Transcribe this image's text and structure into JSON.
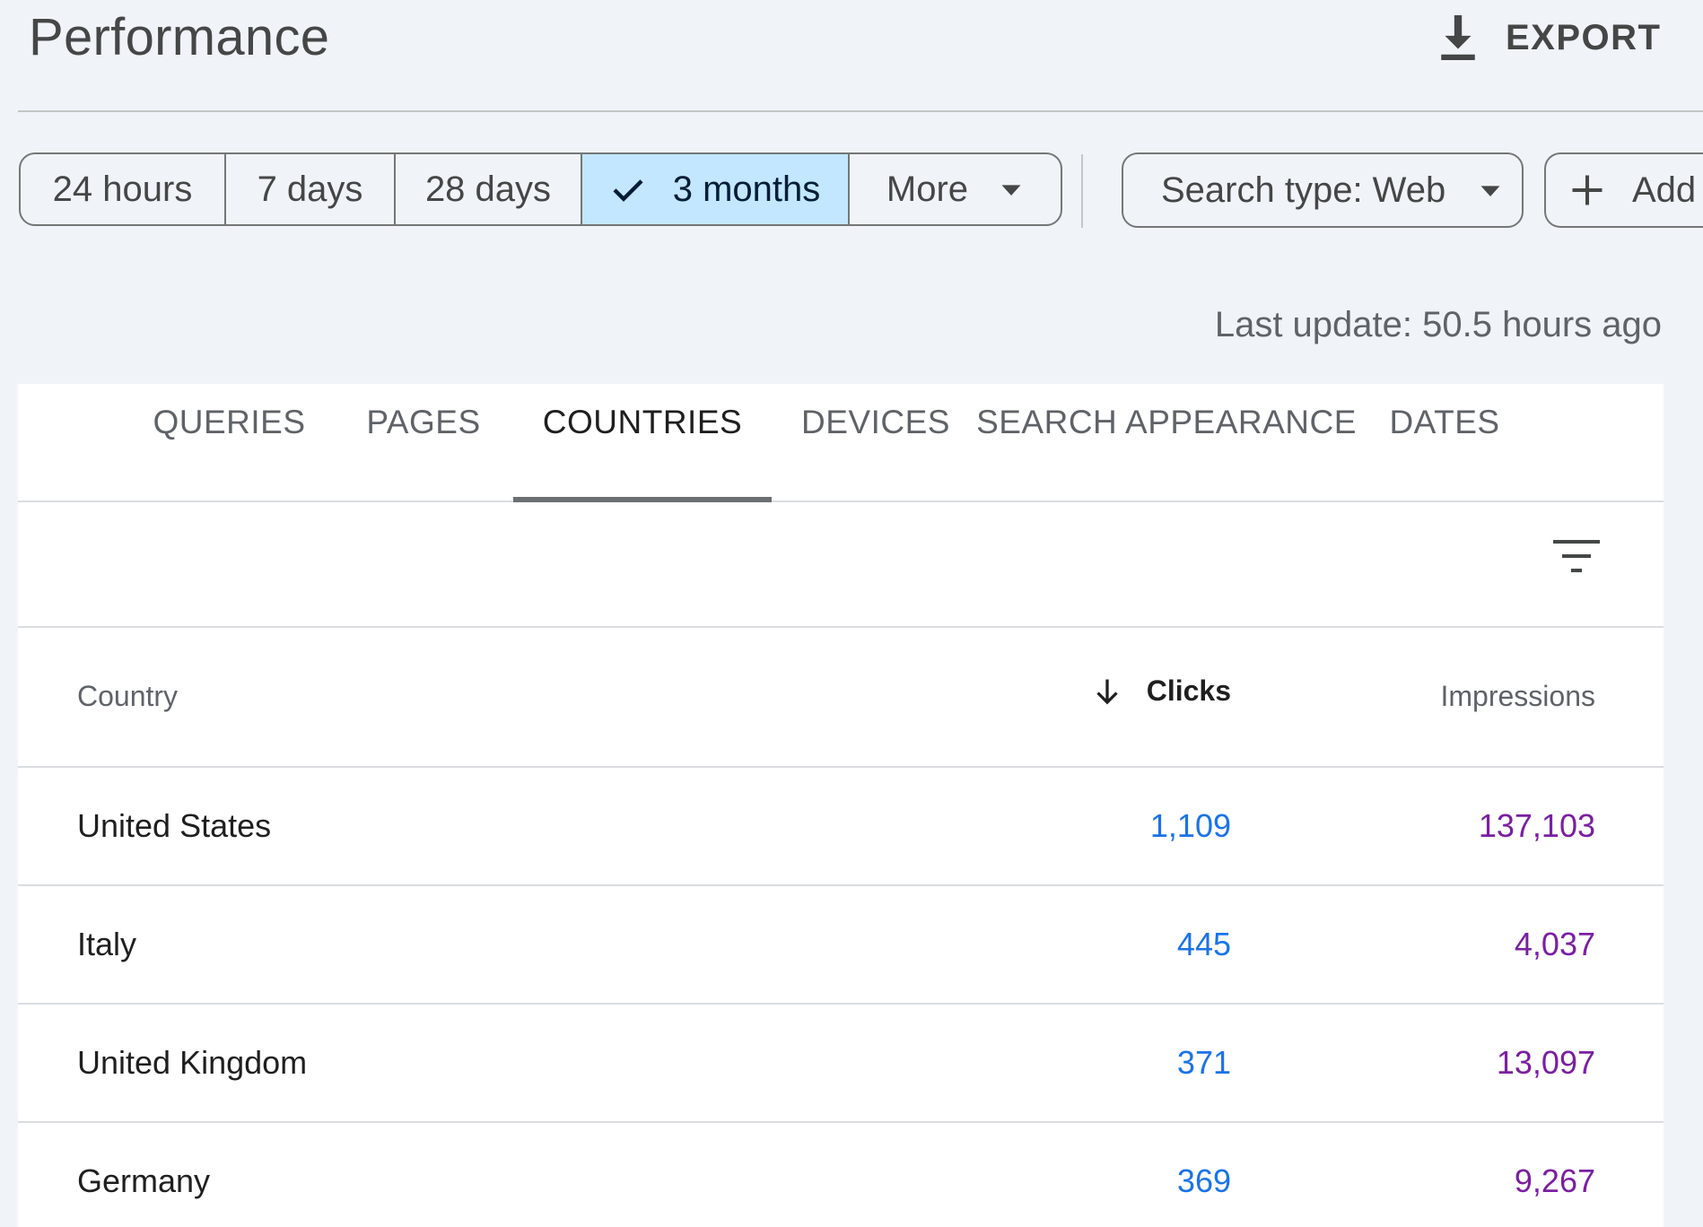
{
  "header": {
    "title": "Performance",
    "export_label": "EXPORT"
  },
  "date_range": {
    "options": [
      {
        "label": "24 hours",
        "selected": false
      },
      {
        "label": "7 days",
        "selected": false
      },
      {
        "label": "28 days",
        "selected": false
      },
      {
        "label": "3 months",
        "selected": true
      },
      {
        "label": "More",
        "selected": false
      }
    ]
  },
  "filters": {
    "search_type_label": "Search type: Web",
    "add_filter_label": "Add f"
  },
  "last_update": "Last update: 50.5 hours ago",
  "tabs": [
    {
      "label": "QUERIES",
      "active": false
    },
    {
      "label": "PAGES",
      "active": false
    },
    {
      "label": "COUNTRIES",
      "active": true
    },
    {
      "label": "DEVICES",
      "active": false
    },
    {
      "label": "SEARCH APPEARANCE",
      "active": false
    },
    {
      "label": "DATES",
      "active": false
    }
  ],
  "table": {
    "columns": {
      "country": "Country",
      "clicks": "Clicks",
      "impressions": "Impressions"
    },
    "sort": {
      "column": "clicks",
      "direction": "descending"
    },
    "rows": [
      {
        "country": "United States",
        "clicks": "1,109",
        "impressions": "137,103"
      },
      {
        "country": "Italy",
        "clicks": "445",
        "impressions": "4,037"
      },
      {
        "country": "United Kingdom",
        "clicks": "371",
        "impressions": "13,097"
      },
      {
        "country": "Germany",
        "clicks": "369",
        "impressions": "9,267"
      }
    ]
  },
  "colors": {
    "background": "#f0f4f9",
    "selected_segment": "#c2e7ff",
    "clicks_value": "#1a73e8",
    "impressions_value": "#7b1fa2"
  },
  "icons": {
    "export": "download-icon",
    "selected": "check-icon",
    "dropdown": "caret-down-icon",
    "add": "plus-icon",
    "table_filter": "filter-icon",
    "sort": "arrow-down-icon"
  }
}
